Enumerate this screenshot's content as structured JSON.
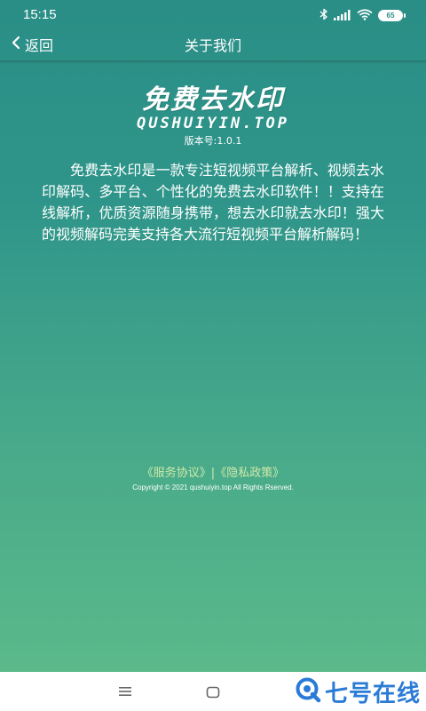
{
  "status_bar": {
    "time": "15:15",
    "battery": "65"
  },
  "nav": {
    "back_label": "返回",
    "title": "关于我们"
  },
  "logo": {
    "title": "免费去水印",
    "domain": "QUSHUIYIN.TOP"
  },
  "version": "版本号:1.0.1",
  "description": "免费去水印是一款专注短视频平台解析、视频去水印解码、多平台、个性化的免费去水印软件！！支持在线解析，优质资源随身携带，想去水印就去水印！强大的视频解码完美支持各大流行短视频平台解析解码！",
  "footer": {
    "service_agreement": "《服务协议》",
    "separator": "|",
    "privacy_policy": "《隐私政策》",
    "copyright": "Copyright © 2021 qushuiyin.top All Rights Rserved."
  },
  "watermark": {
    "text": "七号在线"
  },
  "colors": {
    "gradient_top": "#2a8e86",
    "gradient_bottom": "#5bb98a",
    "link": "#cfe9a9",
    "watermark": "#2a7bd6"
  }
}
